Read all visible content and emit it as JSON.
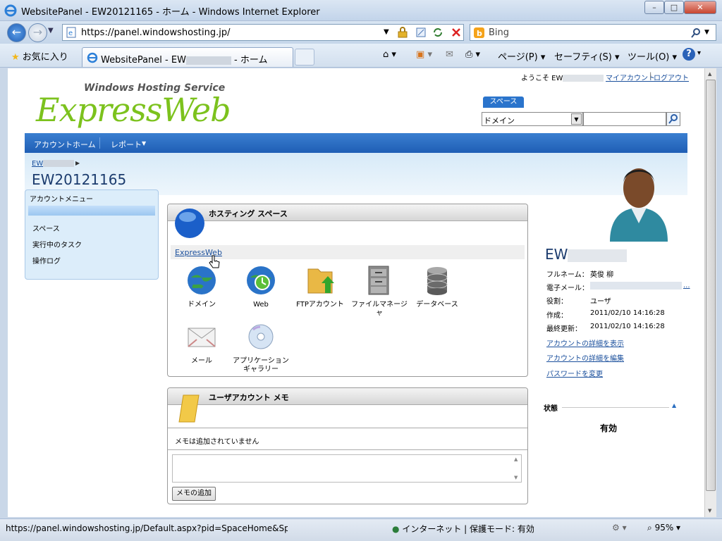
{
  "window": {
    "title": "WebsitePanel - EW20121165 - ホーム - Windows Internet Explorer",
    "minimize": "–",
    "maximize": "□",
    "close": "✕"
  },
  "nav": {
    "url_prefix": "https://",
    "url": "panel.windowshosting.jp/",
    "search_placeholder": "Bing"
  },
  "favbar": {
    "favorites": "お気に入り",
    "tab_title_pre": "WebsitePanel - EW",
    "tab_title_post": " - ホーム",
    "page_menu": "ページ(P)",
    "safety_menu": "セーフティ(S)",
    "tools_menu": "ツール(O)"
  },
  "header": {
    "welcome_prefix": "ようこそ EW",
    "my_account": "マイアカウント",
    "separator": "|",
    "logout": "ログアウト",
    "logo_small": "Windows Hosting Service",
    "logo_big": "ExpressWeb",
    "space_label": "スペース",
    "search_select": "ドメイン"
  },
  "menu": {
    "account_home": "アカウントホーム",
    "reports": "レポート"
  },
  "breadcrumb": {
    "item": "EW",
    "title": "EW20121165"
  },
  "left_menu": {
    "title": "アカウントメニュー",
    "items": [
      "スペース",
      "実行中のタスク",
      "操作ログ"
    ]
  },
  "hosting": {
    "title": "ホスティング スペース",
    "space_link": "ExpressWeb",
    "icons": [
      {
        "label": "ドメイン",
        "icon": "globe-icon"
      },
      {
        "label": "Web",
        "icon": "web-globe-icon"
      },
      {
        "label": "FTPアカウント",
        "icon": "ftp-folder-icon"
      },
      {
        "label": "ファイルマネージャ",
        "icon": "file-cabinet-icon"
      },
      {
        "label": "データベース",
        "icon": "database-icon"
      },
      {
        "label": "メール",
        "icon": "mail-icon"
      },
      {
        "label": "アプリケーションギャラリー",
        "icon": "cd-icon"
      }
    ]
  },
  "memo": {
    "title": "ユーザアカウント メモ",
    "empty": "メモは追加されていません",
    "add_button": "メモの追加"
  },
  "account": {
    "name_prefix": "EW",
    "rows": [
      {
        "label": "フルネーム：",
        "value": "英俊 柳"
      },
      {
        "label": "電子メール：",
        "value": "..."
      },
      {
        "label": "役割：",
        "value": "ユーザ"
      },
      {
        "label": "作成：",
        "value": "2011/02/10 14:16:28"
      },
      {
        "label": "最終更新：",
        "value": "2011/02/10 14:16:28"
      }
    ],
    "links": [
      "アカウントの詳細を表示",
      "アカウントの詳細を編集",
      "パスワードを変更"
    ],
    "status_label": "状態",
    "status_value": "有効"
  },
  "statusbar": {
    "url": "https://panel.windowshosting.jp/Default.aspx?pid=SpaceHome&Spa",
    "zone": "インターネット | 保護モード: 有効",
    "zoom": "95%"
  },
  "colors": {
    "accent": "#1f5eb5",
    "link": "#1a4f9c",
    "logo_green": "#7cc21d"
  }
}
